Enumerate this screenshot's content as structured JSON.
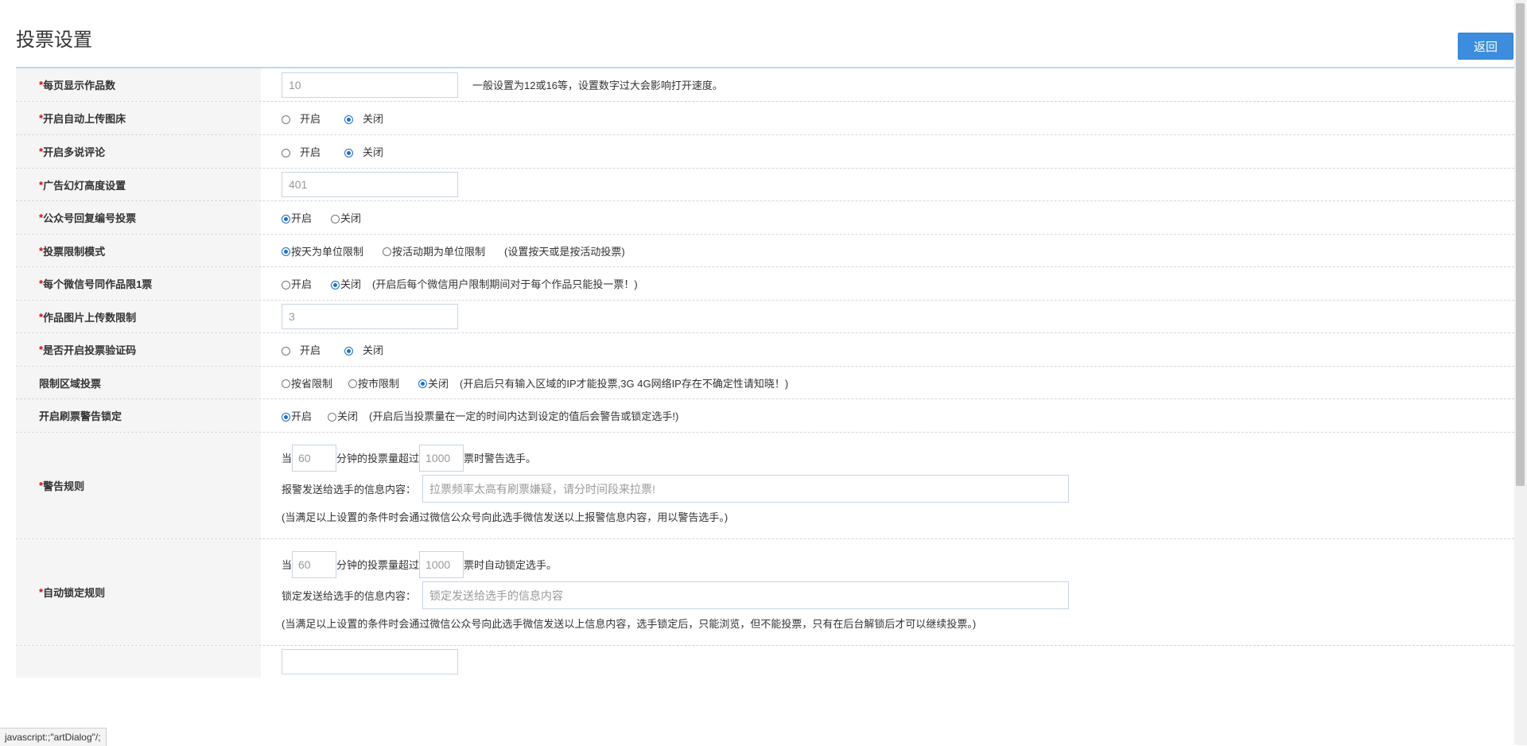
{
  "page": {
    "title": "投票设置",
    "back_label": "返回"
  },
  "rows": [
    {
      "label": "每页显示作品数",
      "required": true,
      "type": "text",
      "value": "10",
      "hint": "一般设置为12或16等，设置数字过大会影响打开速度。"
    },
    {
      "label": "开启自动上传图床",
      "required": true,
      "type": "radio",
      "options": [
        "开启",
        "关闭"
      ],
      "selected": 1
    },
    {
      "label": "开启多说评论",
      "required": true,
      "type": "radio",
      "options": [
        "开启",
        "关闭"
      ],
      "selected": 1
    },
    {
      "label": "广告幻灯高度设置",
      "required": true,
      "type": "text",
      "value": "401"
    },
    {
      "label": "公众号回复编号投票",
      "required": true,
      "type": "radio",
      "options": [
        "开启",
        "关闭"
      ],
      "selected": 0
    },
    {
      "label": "投票限制模式",
      "required": true,
      "type": "radio",
      "options": [
        "按天为单位限制",
        "按活动期为单位限制"
      ],
      "selected": 0,
      "hint": "(设置按天或是按活动投票)"
    },
    {
      "label": "每个微信号同作品限1票",
      "required": true,
      "type": "radio",
      "options": [
        "开启",
        "关闭"
      ],
      "selected": 1,
      "hint": "(开启后每个微信用户限制期间对于每个作品只能投一票！)"
    },
    {
      "label": "作品图片上传数限制",
      "required": true,
      "type": "text",
      "value": "3"
    },
    {
      "label": "是否开启投票验证码",
      "required": true,
      "type": "radio",
      "options": [
        "开启",
        "关闭"
      ],
      "selected": 1
    },
    {
      "label": "限制区域投票",
      "required": false,
      "type": "radio",
      "options": [
        "按省限制",
        "按市限制",
        "关闭"
      ],
      "selected": 2,
      "hint": "(开启后只有输入区域的IP才能投票,3G 4G网络IP存在不确定性请知晓！)"
    },
    {
      "label": "开启刷票警告锁定",
      "required": false,
      "type": "radio",
      "options": [
        "开启",
        "关闭"
      ],
      "selected": 0,
      "hint": "(开启后当投票量在一定的时间内达到设定的值后会警告或锁定选手!)"
    }
  ],
  "warn_rule": {
    "label": "警告规则",
    "prefix": "当",
    "minutes": "60",
    "middle": "分钟的投票量超过",
    "votes": "1000",
    "suffix": "票时警告选手。",
    "msg_label": "报警发送给选手的信息内容：",
    "msg_placeholder": "拉票频率太高有刷票嫌疑，请分时间段来拉票!",
    "note": "(当满足以上设置的条件时会通过微信公众号向此选手微信发送以上报警信息内容，用以警告选手。)"
  },
  "lock_rule": {
    "label": "自动锁定规则",
    "prefix": "当",
    "minutes": "60",
    "middle": "分钟的投票量超过",
    "votes": "1000",
    "suffix": "票时自动锁定选手。",
    "msg_label": "锁定发送给选手的信息内容：",
    "msg_placeholder": "锁定发送给选手的信息内容",
    "note": "(当满足以上设置的条件时会通过微信公众号向此选手微信发送以上信息内容，选手锁定后，只能浏览，但不能投票，只有在后台解锁后才可以继续投票。)"
  },
  "status_bar": "javascript:;\"artDialog\"/;"
}
